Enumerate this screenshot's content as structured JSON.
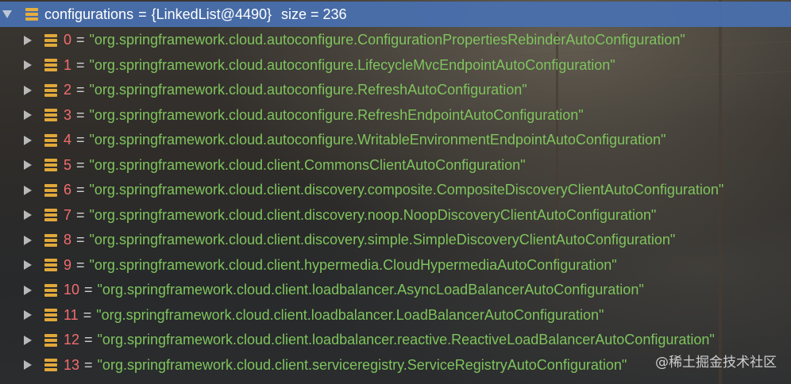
{
  "root": {
    "name": "configurations",
    "value": "{LinkedList@4490}",
    "size_label": "size = 236"
  },
  "items": [
    {
      "index": "0",
      "value": "\"org.springframework.cloud.autoconfigure.ConfigurationPropertiesRebinderAutoConfiguration\""
    },
    {
      "index": "1",
      "value": "\"org.springframework.cloud.autoconfigure.LifecycleMvcEndpointAutoConfiguration\""
    },
    {
      "index": "2",
      "value": "\"org.springframework.cloud.autoconfigure.RefreshAutoConfiguration\""
    },
    {
      "index": "3",
      "value": "\"org.springframework.cloud.autoconfigure.RefreshEndpointAutoConfiguration\""
    },
    {
      "index": "4",
      "value": "\"org.springframework.cloud.autoconfigure.WritableEnvironmentEndpointAutoConfiguration\""
    },
    {
      "index": "5",
      "value": "\"org.springframework.cloud.client.CommonsClientAutoConfiguration\""
    },
    {
      "index": "6",
      "value": "\"org.springframework.cloud.client.discovery.composite.CompositeDiscoveryClientAutoConfiguration\""
    },
    {
      "index": "7",
      "value": "\"org.springframework.cloud.client.discovery.noop.NoopDiscoveryClientAutoConfiguration\""
    },
    {
      "index": "8",
      "value": "\"org.springframework.cloud.client.discovery.simple.SimpleDiscoveryClientAutoConfiguration\""
    },
    {
      "index": "9",
      "value": "\"org.springframework.cloud.client.hypermedia.CloudHypermediaAutoConfiguration\""
    },
    {
      "index": "10",
      "value": "\"org.springframework.cloud.client.loadbalancer.AsyncLoadBalancerAutoConfiguration\""
    },
    {
      "index": "11",
      "value": "\"org.springframework.cloud.client.loadbalancer.LoadBalancerAutoConfiguration\""
    },
    {
      "index": "12",
      "value": "\"org.springframework.cloud.client.loadbalancer.reactive.ReactiveLoadBalancerAutoConfiguration\""
    },
    {
      "index": "13",
      "value": "\"org.springframework.cloud.client.serviceregistry.ServiceRegistryAutoConfiguration\""
    }
  ],
  "equals": "=",
  "icons": {
    "expanded": "triangle-down-icon",
    "collapsed": "triangle-right-icon",
    "field": "field-icon"
  },
  "colors": {
    "header_bg": "#4870af",
    "index": "#f26d6d",
    "string": "#7fc45d",
    "field_icon": "#e0a83a"
  },
  "watermark": "@稀土掘金技术社区"
}
